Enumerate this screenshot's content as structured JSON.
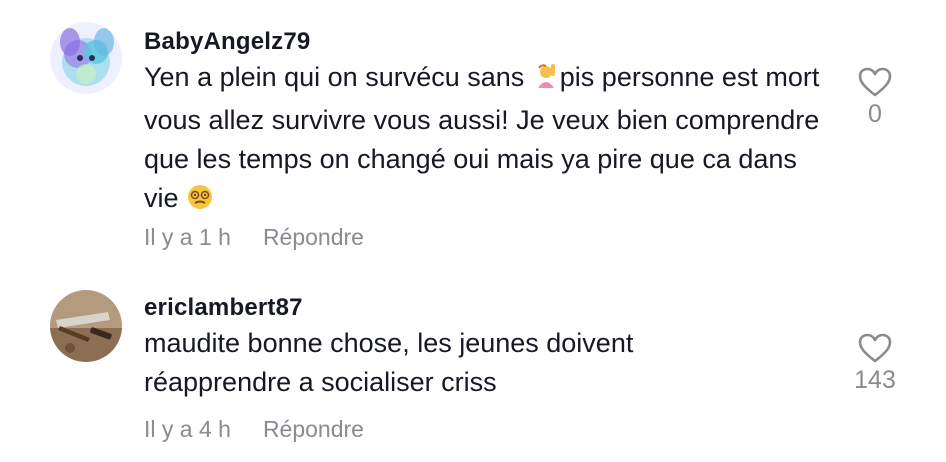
{
  "comments": [
    {
      "username": "BabyAngelz79",
      "text_before_emoji": "Yen a plein qui on survécu sans ",
      "emoji_1": "person-raising-hand-emoji",
      "text_line1_rest": "pis personne est",
      "text_rest": "mort vous allez survivre vous aussi! Je veux bien comprendre que les temps on changé oui mais ya pire que ca dans vie ",
      "emoji_2": "dizzy-face-emoji",
      "time": "Il y a 1 h",
      "reply_label": "Répondre",
      "like_count": "0"
    },
    {
      "username": "ericlambert87",
      "text": "maudite bonne chose, les jeunes doivent réapprendre a socialiser criss",
      "time": "Il y a 4 h",
      "reply_label": "Répondre",
      "like_count": "143"
    }
  ],
  "colors": {
    "text": "#161823",
    "muted": "#8a8b91"
  }
}
